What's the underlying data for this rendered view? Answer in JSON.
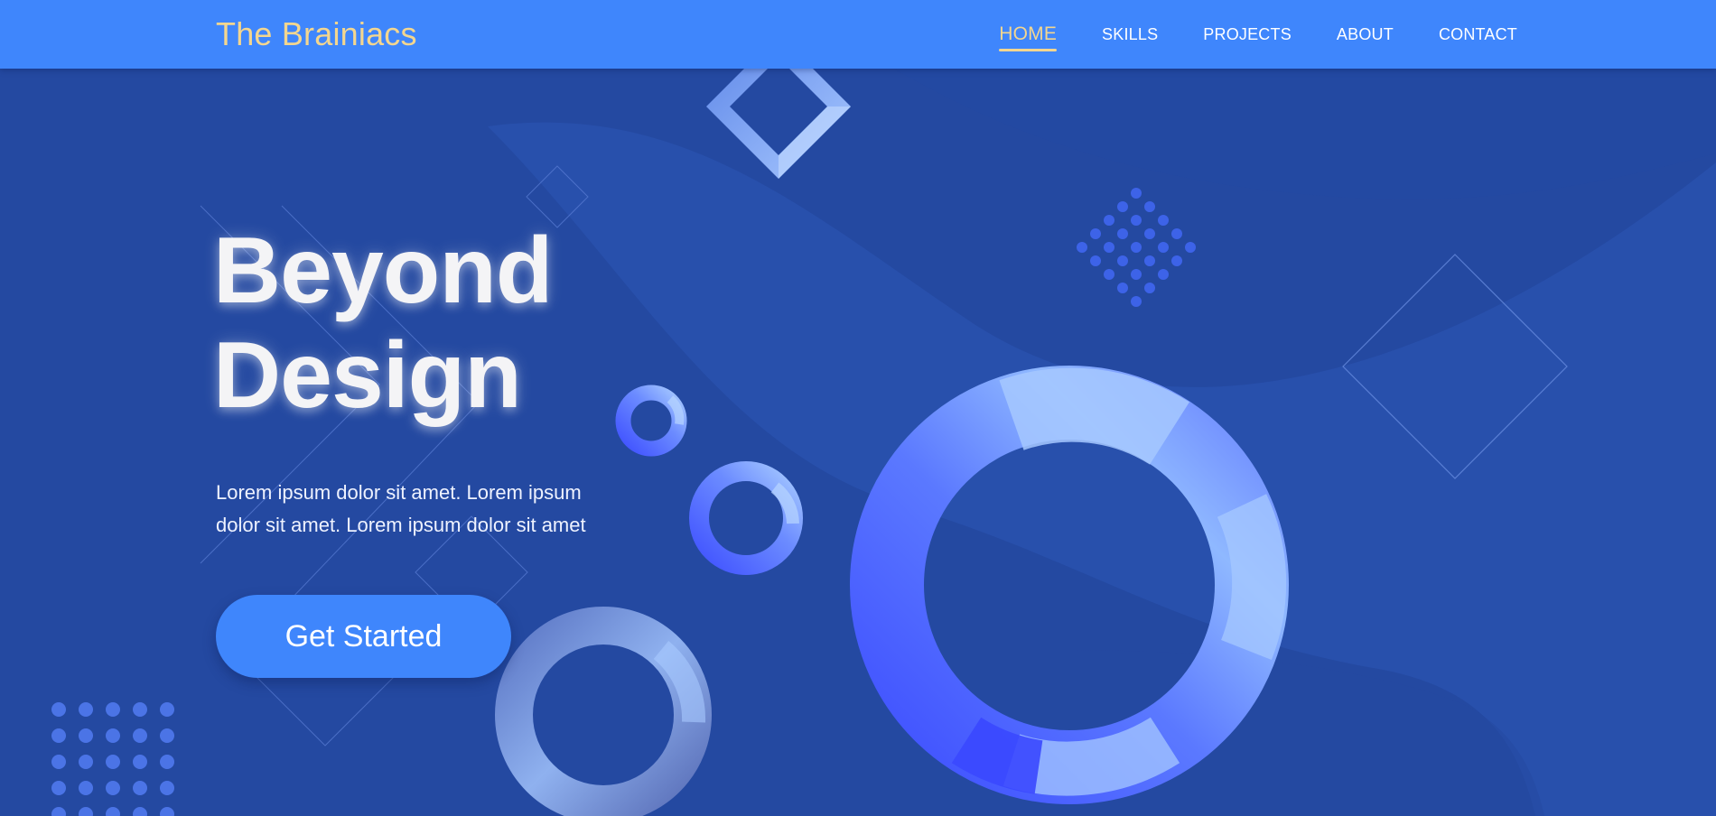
{
  "brand": {
    "name": "The Brainiacs",
    "color": "#f3d68f"
  },
  "nav": {
    "items": [
      {
        "label": "HOME",
        "active": true
      },
      {
        "label": "SKILLS",
        "active": false
      },
      {
        "label": "PROJECTS",
        "active": false
      },
      {
        "label": "ABOUT",
        "active": false
      },
      {
        "label": "CONTACT",
        "active": false
      }
    ]
  },
  "hero": {
    "title_line1": "Beyond",
    "title_line2": "Design",
    "paragraph": "Lorem ipsum dolor sit amet. Lorem ipsum dolor sit amet. Lorem ipsum dolor sit amet",
    "cta_label": "Get Started"
  },
  "colors": {
    "header": "#3f86fc",
    "background": "#2449a1",
    "accent_gold": "#f3d68f",
    "button": "#3f86fc",
    "ring_blue": "#4a5cff",
    "ring_light": "#9ec4ff"
  }
}
